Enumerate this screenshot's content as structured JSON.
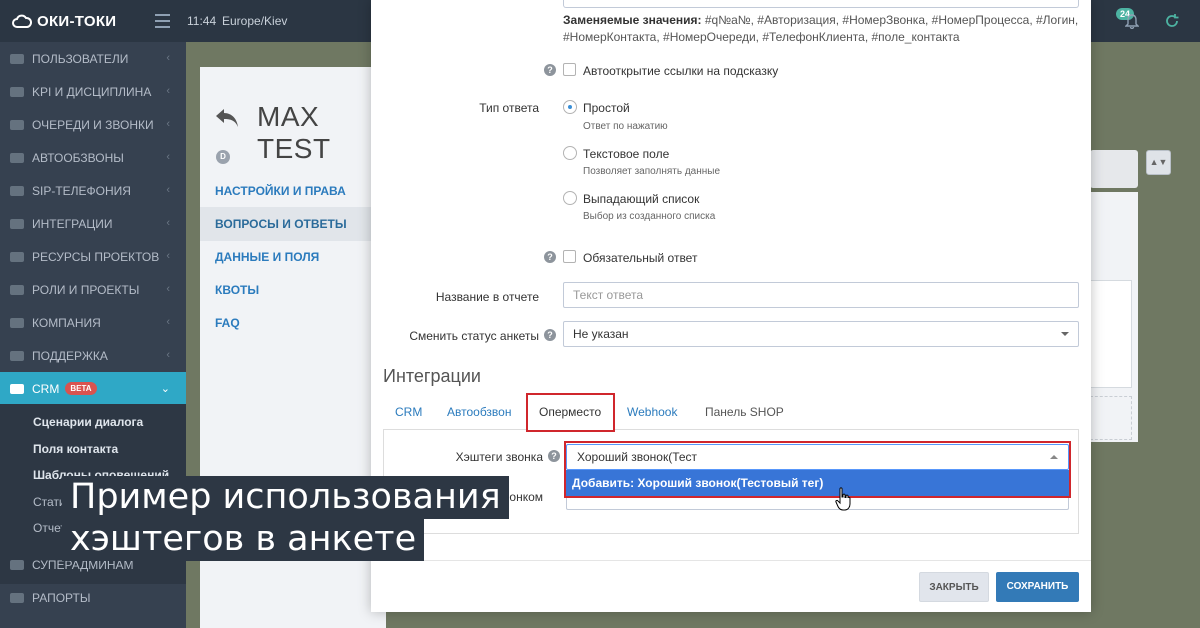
{
  "topbar": {
    "brand": "ОКИ-ТОКИ",
    "time": "11:44",
    "timezone": "Europe/Kiev",
    "notifications": "24"
  },
  "sidebar": {
    "items": [
      {
        "label": "ПОЛЬЗОВАТЕЛИ",
        "icon": "user-icon"
      },
      {
        "label": "KPI И ДИСЦИПЛИНА",
        "icon": "check-icon"
      },
      {
        "label": "ОЧЕРЕДИ И ЗВОНКИ",
        "icon": "list-icon"
      },
      {
        "label": "АВТООБЗВОНЫ",
        "icon": "clock-icon"
      },
      {
        "label": "SIP-ТЕЛЕФОНИЯ",
        "icon": "phone-icon"
      },
      {
        "label": "ИНТЕГРАЦИИ",
        "icon": "gears-icon"
      },
      {
        "label": "РЕСУРСЫ ПРОЕКТОВ",
        "icon": "grid-icon"
      },
      {
        "label": "РОЛИ И ПРОЕКТЫ",
        "icon": "toggle-icon"
      },
      {
        "label": "КОМПАНИЯ",
        "icon": "chart-icon"
      },
      {
        "label": "ПОДДЕРЖКА",
        "icon": "wrench-icon"
      }
    ],
    "crm": {
      "label": "CRM",
      "badge": "BETA"
    },
    "sub_items": [
      "Сценарии диалога",
      "Поля контакта",
      "Шаблоны оповещений",
      "Стати",
      "Отчет"
    ],
    "bottom_items": [
      "СУПЕРАДМИНАМ",
      "РАПОРТЫ"
    ]
  },
  "page": {
    "title": "MAX TEST",
    "avatar_letter": "D",
    "links": [
      "НАСТРОЙКИ И ПРАВА",
      "ВОПРОСЫ И ОТВЕТЫ",
      "ДАННЫЕ И ПОЛЯ",
      "КВОТЫ",
      "FAQ"
    ]
  },
  "modal": {
    "replace_label": "Заменяемые значения:",
    "replace_values": "#q№а№, #Авторизация, #НомерЗвонка, #НомерПроцесса, #Логин, #НомерКонтакта, #НомерОчереди, #ТелефонКлиента, #поле_контакта",
    "autoopen_label": "Автооткрытие ссылки на подсказку",
    "answer_type_label": "Тип ответа",
    "answer_types": [
      {
        "label": "Простой",
        "sub": "Ответ по нажатию",
        "checked": true
      },
      {
        "label": "Текстовое поле",
        "sub": "Позволяет заполнять данные",
        "checked": false
      },
      {
        "label": "Выпадающий список",
        "sub": "Выбор из созданного списка",
        "checked": false
      }
    ],
    "required_label": "Обязательный ответ",
    "report_name_label": "Название в отчете",
    "report_name_placeholder": "Текст ответа",
    "change_status_label": "Сменить статус анкеты",
    "change_status_value": "Не указан",
    "integrations_title": "Интеграции",
    "tabs": [
      "CRM",
      "Автообзвон",
      "Оперместо",
      "Webhook",
      "Панель SHOP"
    ],
    "active_tab": "Оперместо",
    "hashtags_label": "Хэштеги звонка",
    "hashtags_value": "Хороший звонок(Тест",
    "dropdown_option": "Добавить: Хороший звонок(Тестовый тег)",
    "behind_label": "онком",
    "close_button": "ЗАКРЫТЬ",
    "save_button": "СОХРАНИТЬ"
  },
  "caption": {
    "line1": "Пример использования",
    "line2": "хэштегов в анкете"
  },
  "colors": {
    "topbar": "#2b3643",
    "sidebar": "#364150",
    "active": "#2fa8c6",
    "primary": "#337ab7",
    "highlight": "#d0262c",
    "dropdown": "#3875d7"
  }
}
